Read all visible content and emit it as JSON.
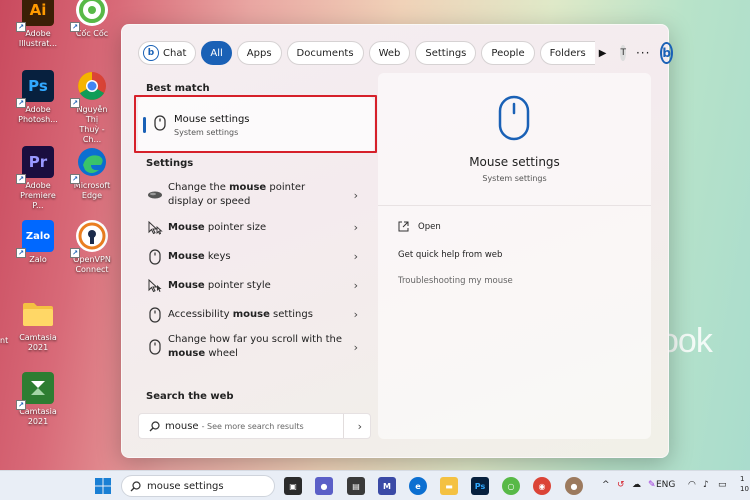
{
  "desktop": {
    "icons": [
      {
        "label": "Adobe\nIllustrat...",
        "glyph": "Ai",
        "color": "#3b1f06",
        "fg": "#ff9a00"
      },
      {
        "label": "Cốc Cốc",
        "glyph": "",
        "color": "#58b947",
        "fg": "#fff"
      },
      {
        "label": "Adobe\nPhotosh...",
        "glyph": "Ps",
        "color": "#07203e",
        "fg": "#31a8ff"
      },
      {
        "label": "Nguyễn Thị\nThuỳ - Ch...",
        "glyph": "",
        "color": "#ffffff",
        "fg": "#333"
      },
      {
        "label": "Adobe\nPremiere P...",
        "glyph": "Pr",
        "color": "#1a0e3f",
        "fg": "#9999ff"
      },
      {
        "label": "Microsoft\nEdge",
        "glyph": "",
        "color": "#0c6fd1",
        "fg": "#fff"
      },
      {
        "label": "Zalo",
        "glyph": "Zalo",
        "color": "#0068ff",
        "fg": "#fff"
      },
      {
        "label": "OpenVPN\nConnect",
        "glyph": "",
        "color": "#ffffff",
        "fg": "#ea7e20"
      },
      {
        "label": "Camtasia\n2021",
        "glyph": "",
        "color": "#f4c142",
        "fg": "#fff"
      },
      {
        "label": "Camtasia\n2021",
        "glyph": "",
        "color": "#2e7d32",
        "fg": "#fff"
      }
    ],
    "left_edge_text": "nt",
    "brand_fragment": "ook"
  },
  "panel": {
    "filters": {
      "chat": "Chat",
      "all": "All",
      "apps": "Apps",
      "documents": "Documents",
      "web": "Web",
      "settings": "Settings",
      "people": "People",
      "folders": "Folders",
      "avatar_initial": "T",
      "more": "···"
    },
    "best_match": {
      "heading": "Best match",
      "title": "Mouse settings",
      "subtitle": "System settings"
    },
    "settings": {
      "heading": "Settings",
      "items": [
        {
          "pre": "Change the ",
          "bold": "mouse",
          "post": " pointer display or speed",
          "icon": "pointer-speed-icon",
          "tall": true
        },
        {
          "pre": "",
          "bold": "Mouse",
          "post": " pointer size",
          "icon": "pointer-size-icon",
          "tall": false
        },
        {
          "pre": "",
          "bold": "Mouse",
          "post": " keys",
          "icon": "mouse-keys-icon",
          "tall": false
        },
        {
          "pre": "",
          "bold": "Mouse",
          "post": " pointer style",
          "icon": "pointer-style-icon",
          "tall": false
        },
        {
          "pre": "Accessibility ",
          "bold": "mouse",
          "post": " settings",
          "icon": "accessibility-mouse-icon",
          "tall": false
        },
        {
          "pre": "Change how far you scroll with the ",
          "bold": "mouse",
          "post": " wheel",
          "icon": "scroll-wheel-icon",
          "tall": true
        }
      ]
    },
    "web": {
      "heading": "Search the web",
      "query": "mouse",
      "hint": "- See more search results"
    },
    "detail": {
      "title": "Mouse settings",
      "subtitle": "System settings",
      "actions": {
        "open": "Open",
        "help": "Get quick help from web",
        "troubleshoot": "Troubleshooting my mouse"
      }
    }
  },
  "taskbar": {
    "search_value": "mouse settings",
    "lang": "ENG",
    "clock_fragment": "1\n10"
  }
}
